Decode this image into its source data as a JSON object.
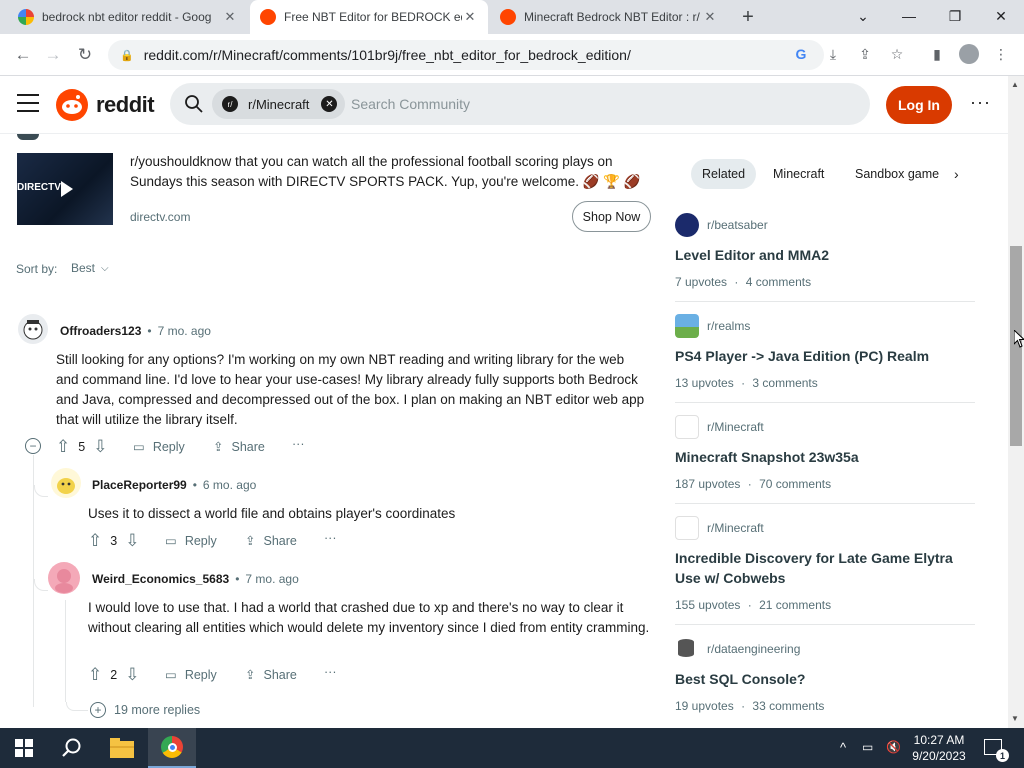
{
  "browser": {
    "tabs": [
      {
        "title": "bedrock nbt editor reddit - Goog",
        "icon": "google-icon",
        "active": false
      },
      {
        "title": "Free NBT Editor for BEDROCK ed",
        "icon": "reddit-icon",
        "active": true
      },
      {
        "title": "Minecraft Bedrock NBT Editor : r/",
        "icon": "reddit-icon",
        "active": false
      }
    ],
    "new_tab": "+",
    "url": "reddit.com/r/Minecraft/comments/101br9j/free_nbt_editor_for_bedrock_edition/"
  },
  "header": {
    "logo_text": "reddit",
    "community_chip": "r/Minecraft",
    "search_placeholder": "Search Community",
    "login_label": "Log In"
  },
  "ad": {
    "text": "r/youshouldknow that you can watch all the professional football scoring plays on Sundays this season with DIRECTV SPORTS PACK. Yup, you're welcome. 🏈 🏆 🏈",
    "domain": "directv.com",
    "button": "Shop Now",
    "thumb_text": "DIRECTV"
  },
  "sort": {
    "label": "Sort by:",
    "value": "Best"
  },
  "comments": [
    {
      "user": "Offroaders123",
      "time": "7 mo. ago",
      "text": "Still looking for any options? I'm working on my own NBT reading and writing library for the web and command line. I'd love to hear your use-cases! My library already fully supports both Bedrock and Java, compressed and decompressed out of the box. I plan on making an NBT editor web app that will utilize the library itself.",
      "votes": "5"
    },
    {
      "user": "PlaceReporter99",
      "time": "6 mo. ago",
      "text": "Uses it to dissect a world file and obtains player's coordinates",
      "votes": "3"
    },
    {
      "user": "Weird_Economics_5683",
      "time": "7 mo. ago",
      "text": "I would love to use that. I had a world that crashed due to xp and there's no way to clear it without clearing all entities which would delete my inventory since I died from entity cramming.",
      "votes": "2"
    }
  ],
  "actions": {
    "reply": "Reply",
    "share": "Share",
    "more": "···",
    "separator": "•"
  },
  "more_replies": "19 more replies",
  "sidebar": {
    "tabs": [
      "Related",
      "Minecraft",
      "Sandbox game"
    ],
    "posts": [
      {
        "sub": "r/beatsaber",
        "title": "Level Editor and MMA2",
        "upvotes": "7 upvotes",
        "comments": "4 comments"
      },
      {
        "sub": "r/realms",
        "title": "PS4 Player -> Java Edition (PC) Realm",
        "upvotes": "13 upvotes",
        "comments": "3 comments"
      },
      {
        "sub": "r/Minecraft",
        "title": "Minecraft Snapshot 23w35a",
        "upvotes": "187 upvotes",
        "comments": "70 comments"
      },
      {
        "sub": "r/Minecraft",
        "title": "Incredible Discovery for Late Game Elytra Use w/ Cobwebs",
        "upvotes": "155 upvotes",
        "comments": "21 comments"
      },
      {
        "sub": "r/dataengineering",
        "title": "Best SQL Console?",
        "upvotes": "19 upvotes",
        "comments": "33 comments"
      }
    ],
    "dot": "·"
  },
  "taskbar": {
    "time": "10:27 AM",
    "date": "9/20/2023"
  },
  "colors": {
    "brand": "#ff4500",
    "login": "#d93a00",
    "taskbar": "#1e2b3a"
  }
}
